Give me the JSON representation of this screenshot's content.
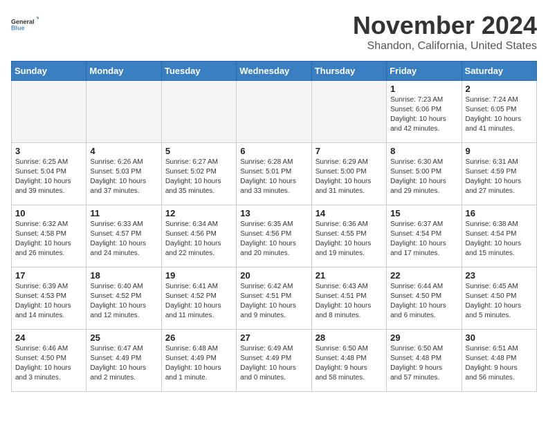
{
  "header": {
    "logo_general": "General",
    "logo_blue": "Blue",
    "month_year": "November 2024",
    "location": "Shandon, California, United States"
  },
  "weekdays": [
    "Sunday",
    "Monday",
    "Tuesday",
    "Wednesday",
    "Thursday",
    "Friday",
    "Saturday"
  ],
  "weeks": [
    [
      {
        "day": "",
        "info": "",
        "empty": true
      },
      {
        "day": "",
        "info": "",
        "empty": true
      },
      {
        "day": "",
        "info": "",
        "empty": true
      },
      {
        "day": "",
        "info": "",
        "empty": true
      },
      {
        "day": "",
        "info": "",
        "empty": true
      },
      {
        "day": "1",
        "info": "Sunrise: 7:23 AM\nSunset: 6:06 PM\nDaylight: 10 hours\nand 42 minutes."
      },
      {
        "day": "2",
        "info": "Sunrise: 7:24 AM\nSunset: 6:05 PM\nDaylight: 10 hours\nand 41 minutes."
      }
    ],
    [
      {
        "day": "3",
        "info": "Sunrise: 6:25 AM\nSunset: 5:04 PM\nDaylight: 10 hours\nand 39 minutes."
      },
      {
        "day": "4",
        "info": "Sunrise: 6:26 AM\nSunset: 5:03 PM\nDaylight: 10 hours\nand 37 minutes."
      },
      {
        "day": "5",
        "info": "Sunrise: 6:27 AM\nSunset: 5:02 PM\nDaylight: 10 hours\nand 35 minutes."
      },
      {
        "day": "6",
        "info": "Sunrise: 6:28 AM\nSunset: 5:01 PM\nDaylight: 10 hours\nand 33 minutes."
      },
      {
        "day": "7",
        "info": "Sunrise: 6:29 AM\nSunset: 5:00 PM\nDaylight: 10 hours\nand 31 minutes."
      },
      {
        "day": "8",
        "info": "Sunrise: 6:30 AM\nSunset: 5:00 PM\nDaylight: 10 hours\nand 29 minutes."
      },
      {
        "day": "9",
        "info": "Sunrise: 6:31 AM\nSunset: 4:59 PM\nDaylight: 10 hours\nand 27 minutes."
      }
    ],
    [
      {
        "day": "10",
        "info": "Sunrise: 6:32 AM\nSunset: 4:58 PM\nDaylight: 10 hours\nand 26 minutes."
      },
      {
        "day": "11",
        "info": "Sunrise: 6:33 AM\nSunset: 4:57 PM\nDaylight: 10 hours\nand 24 minutes."
      },
      {
        "day": "12",
        "info": "Sunrise: 6:34 AM\nSunset: 4:56 PM\nDaylight: 10 hours\nand 22 minutes."
      },
      {
        "day": "13",
        "info": "Sunrise: 6:35 AM\nSunset: 4:56 PM\nDaylight: 10 hours\nand 20 minutes."
      },
      {
        "day": "14",
        "info": "Sunrise: 6:36 AM\nSunset: 4:55 PM\nDaylight: 10 hours\nand 19 minutes."
      },
      {
        "day": "15",
        "info": "Sunrise: 6:37 AM\nSunset: 4:54 PM\nDaylight: 10 hours\nand 17 minutes."
      },
      {
        "day": "16",
        "info": "Sunrise: 6:38 AM\nSunset: 4:54 PM\nDaylight: 10 hours\nand 15 minutes."
      }
    ],
    [
      {
        "day": "17",
        "info": "Sunrise: 6:39 AM\nSunset: 4:53 PM\nDaylight: 10 hours\nand 14 minutes."
      },
      {
        "day": "18",
        "info": "Sunrise: 6:40 AM\nSunset: 4:52 PM\nDaylight: 10 hours\nand 12 minutes."
      },
      {
        "day": "19",
        "info": "Sunrise: 6:41 AM\nSunset: 4:52 PM\nDaylight: 10 hours\nand 11 minutes."
      },
      {
        "day": "20",
        "info": "Sunrise: 6:42 AM\nSunset: 4:51 PM\nDaylight: 10 hours\nand 9 minutes."
      },
      {
        "day": "21",
        "info": "Sunrise: 6:43 AM\nSunset: 4:51 PM\nDaylight: 10 hours\nand 8 minutes."
      },
      {
        "day": "22",
        "info": "Sunrise: 6:44 AM\nSunset: 4:50 PM\nDaylight: 10 hours\nand 6 minutes."
      },
      {
        "day": "23",
        "info": "Sunrise: 6:45 AM\nSunset: 4:50 PM\nDaylight: 10 hours\nand 5 minutes."
      }
    ],
    [
      {
        "day": "24",
        "info": "Sunrise: 6:46 AM\nSunset: 4:50 PM\nDaylight: 10 hours\nand 3 minutes."
      },
      {
        "day": "25",
        "info": "Sunrise: 6:47 AM\nSunset: 4:49 PM\nDaylight: 10 hours\nand 2 minutes."
      },
      {
        "day": "26",
        "info": "Sunrise: 6:48 AM\nSunset: 4:49 PM\nDaylight: 10 hours\nand 1 minute."
      },
      {
        "day": "27",
        "info": "Sunrise: 6:49 AM\nSunset: 4:49 PM\nDaylight: 10 hours\nand 0 minutes."
      },
      {
        "day": "28",
        "info": "Sunrise: 6:50 AM\nSunset: 4:48 PM\nDaylight: 9 hours\nand 58 minutes."
      },
      {
        "day": "29",
        "info": "Sunrise: 6:50 AM\nSunset: 4:48 PM\nDaylight: 9 hours\nand 57 minutes."
      },
      {
        "day": "30",
        "info": "Sunrise: 6:51 AM\nSunset: 4:48 PM\nDaylight: 9 hours\nand 56 minutes."
      }
    ]
  ]
}
